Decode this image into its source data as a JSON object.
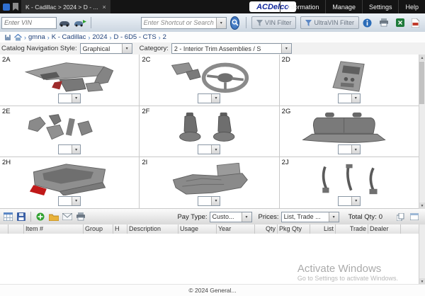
{
  "icons": {
    "chevron_down": "▾",
    "close": "×",
    "breadcrumb_sep": "›",
    "scroll_up": "▲",
    "scroll_down": "▼"
  },
  "colors": {
    "brand_blue": "#12279b",
    "highlight_red": "#c01818"
  },
  "titlebar": {
    "tab_title": "K - Cadillac > 2024 > D - ...",
    "brand": "ACDelco",
    "menu": [
      "Information",
      "Manage",
      "Settings",
      "Help"
    ]
  },
  "toolbar2": {
    "vin_placeholder": "Enter VIN",
    "search_placeholder": "Enter Shortcut or Search",
    "vin_filter_label": "VIN Filter",
    "ultravin_filter_label": "UltraVIN Filter"
  },
  "breadcrumb": {
    "items": [
      "gmna",
      "K - Cadillac",
      "2024",
      "D - 6D5 - CTS",
      "2"
    ]
  },
  "filters": {
    "nav_style_label": "Catalog Navigation Style:",
    "nav_style_value": "Graphical",
    "category_label": "Category:",
    "category_value": "2 - Interior Trim Assemblies / S"
  },
  "grid": {
    "cells": [
      {
        "label": "2A",
        "part": "instrument-panel"
      },
      {
        "label": "2C",
        "part": "steering-wheel"
      },
      {
        "label": "2D",
        "part": "center-console"
      },
      {
        "label": "2E",
        "part": "pedal-brackets"
      },
      {
        "label": "2F",
        "part": "front-seats"
      },
      {
        "label": "2G",
        "part": "rear-seat"
      },
      {
        "label": "2H",
        "part": "trunk-trim"
      },
      {
        "label": "2I",
        "part": "floor-carpet"
      },
      {
        "label": "2J",
        "part": "seat-belts"
      }
    ]
  },
  "parts_toolbar": {
    "pay_type_label": "Pay Type:",
    "pay_type_value": "Custo...",
    "prices_label": "Prices:",
    "prices_value": "List, Trade ...",
    "total_qty_label": "Total Qty:",
    "total_qty_value": "0"
  },
  "table": {
    "columns": [
      "Item #",
      "Group",
      "H",
      "Description",
      "Usage",
      "Year",
      "Qty",
      "Pkg Qty",
      "List",
      "Trade",
      "Dealer"
    ]
  },
  "watermark": {
    "line1": "Activate Windows",
    "line2": "Go to Settings to activate Windows."
  },
  "footer": {
    "copyright": "© 2024 General..."
  }
}
